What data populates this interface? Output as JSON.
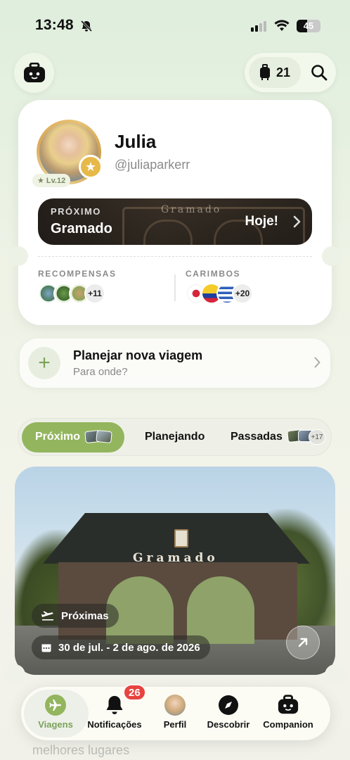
{
  "status_bar": {
    "time": "13:48",
    "battery": "45",
    "battery_level": 0.45
  },
  "header": {
    "bag_count": "21"
  },
  "profile": {
    "name": "Julia",
    "handle": "@juliaparkerr",
    "level": "Lv.12"
  },
  "next_trip": {
    "label": "PRÓXIMO",
    "city": "Gramado",
    "when": "Hoje!",
    "sign": "Gramado"
  },
  "rewards": {
    "label": "RECOMPENSAS",
    "more": "+11"
  },
  "stamps": {
    "label": "CARIMBOS",
    "more": "+20",
    "flags": [
      "Japan",
      "Colombia",
      "Uruguay"
    ]
  },
  "plan": {
    "title": "Planejar nova viagem",
    "subtitle": "Para onde?"
  },
  "tabs": [
    {
      "label": "Próximo",
      "active": true
    },
    {
      "label": "Planejando",
      "active": false
    },
    {
      "label": "Passadas",
      "active": false,
      "more": "+17"
    }
  ],
  "trip_card": {
    "sign": "Gramado",
    "tag": "Próximas",
    "dates": "30 de jul. - 2 de ago. de 2026"
  },
  "faded": {
    "sub": "melhores lugares"
  },
  "tabbar": {
    "items": [
      {
        "label": "Viagens",
        "active": true
      },
      {
        "label": "Notificações",
        "badge": "26"
      },
      {
        "label": "Perfil"
      },
      {
        "label": "Descobrir"
      },
      {
        "label": "Companion"
      }
    ]
  },
  "colors": {
    "accent": "#93b55e",
    "badge": "#e8433f"
  }
}
